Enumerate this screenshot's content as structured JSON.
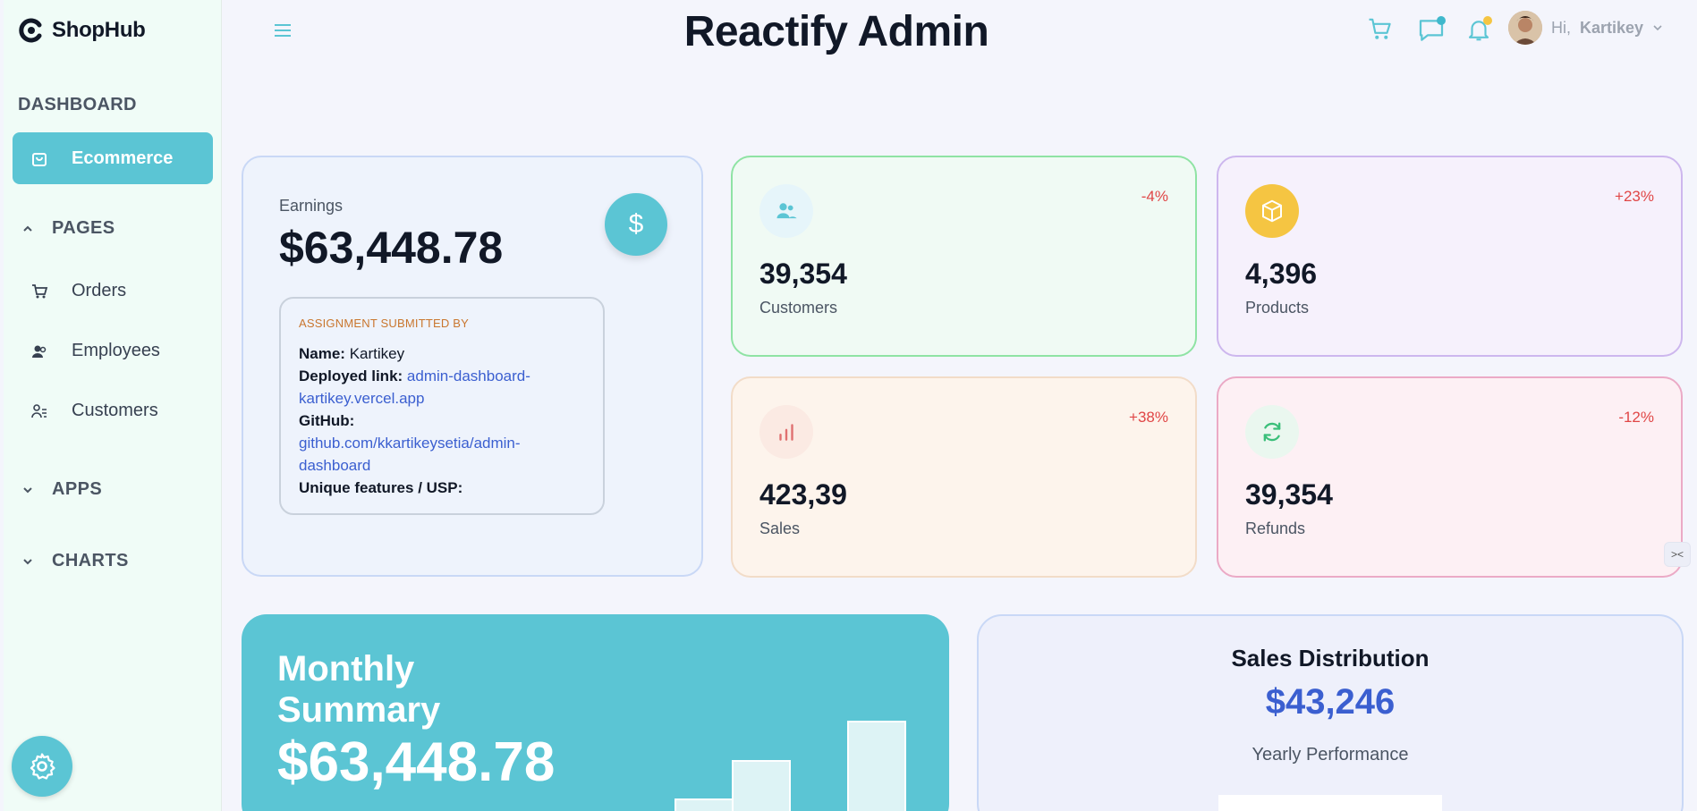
{
  "sidebar": {
    "brand": "ShopHub",
    "dashboard_title": "DASHBOARD",
    "active_item": "Ecommerce",
    "pages_title": "PAGES",
    "pages_items": [
      "Orders",
      "Employees",
      "Customers"
    ],
    "apps_title": "APPS",
    "charts_title": "CHARTS"
  },
  "header": {
    "title": "Reactify Admin",
    "greeting": "Hi,",
    "user_name": "Kartikey"
  },
  "earnings": {
    "label": "Earnings",
    "value": "$63,448.78",
    "currency_symbol": "$"
  },
  "assignment": {
    "heading": "ASSIGNMENT SUBMITTED BY",
    "name_key": "Name:",
    "name_value": "Kartikey",
    "deployed_key": "Deployed link:",
    "deployed_value": "admin-dashboard-kartikey.vercel.app",
    "github_key": "GitHub:",
    "github_value": "github.com/kkartikeysetia/admin-dashboard",
    "usp_key": "Unique features / USP:"
  },
  "stats": [
    {
      "value": "39,354",
      "label": "Customers",
      "change": "-4%"
    },
    {
      "value": "4,396",
      "label": "Products",
      "change": "+23%"
    },
    {
      "value": "423,39",
      "label": "Sales",
      "change": "+38%"
    },
    {
      "value": "39,354",
      "label": "Refunds",
      "change": "-12%"
    }
  ],
  "monthly": {
    "title": "Monthly Summary",
    "value": "$63,448.78"
  },
  "distribution": {
    "title": "Sales Distribution",
    "value": "$43,246",
    "subtitle": "Yearly Performance"
  },
  "colors": {
    "accent": "#5bc5d4",
    "negative": "#e04646",
    "link": "#3b5fd0"
  }
}
